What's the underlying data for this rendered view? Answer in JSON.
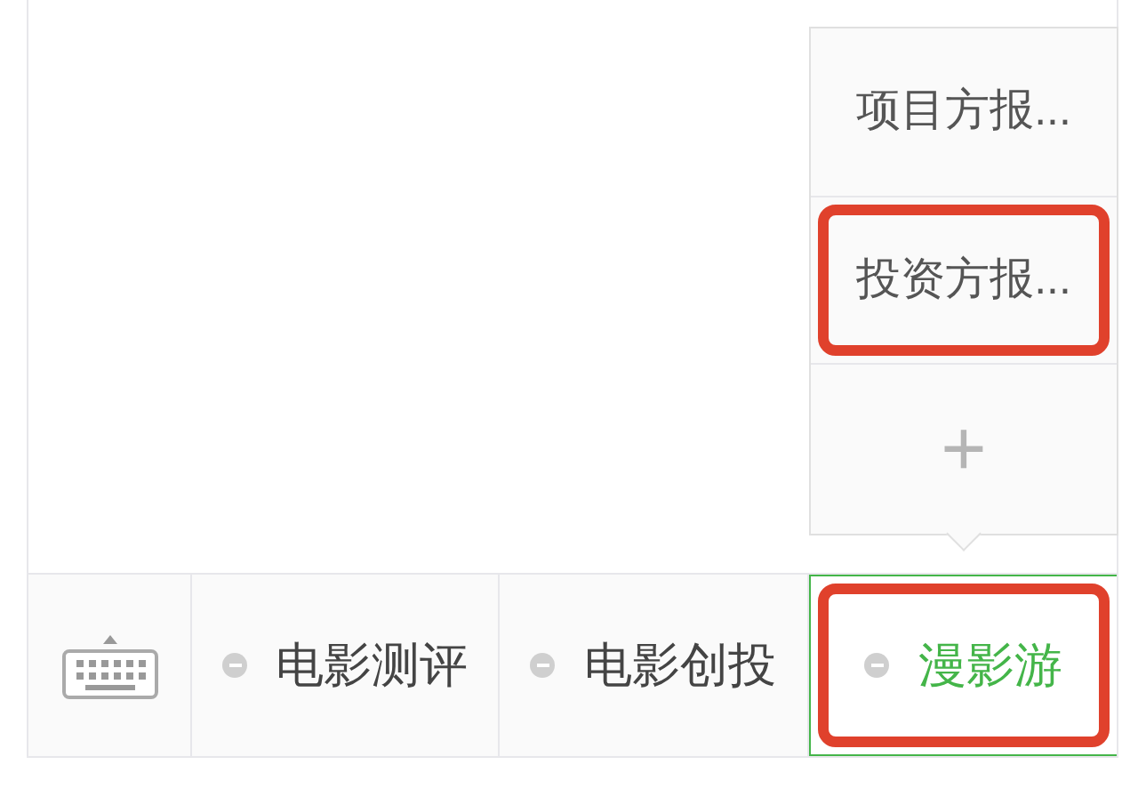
{
  "menu": [
    {
      "label": "电影测评",
      "selected": false,
      "highlighted": false
    },
    {
      "label": "电影创投",
      "selected": false,
      "highlighted": false
    },
    {
      "label": "漫影游",
      "selected": true,
      "highlighted": true,
      "submenu": [
        {
          "kind": "item",
          "label": "项目方报...",
          "highlighted": false
        },
        {
          "kind": "item",
          "label": "投资方报...",
          "highlighted": true
        },
        {
          "kind": "add",
          "label": "+"
        }
      ]
    }
  ]
}
